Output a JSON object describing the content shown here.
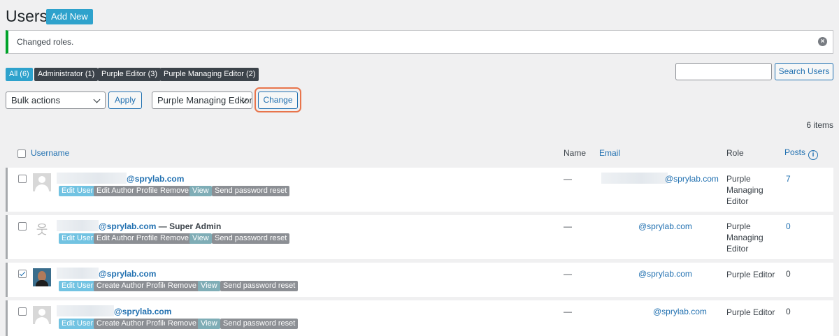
{
  "header": {
    "title": "Users",
    "add_new": "Add New"
  },
  "notice": {
    "message": "Changed roles.",
    "dismiss": "×"
  },
  "filters": [
    {
      "label": "All (6)",
      "active": true
    },
    {
      "label": "Administrator (1)"
    },
    {
      "label": "Purple Editor (3)"
    },
    {
      "label": "Purple Managing Editor (2)"
    }
  ],
  "search": {
    "placeholder": "",
    "button": "Search Users"
  },
  "bulk": {
    "selected": "Bulk actions",
    "apply": "Apply"
  },
  "role_change": {
    "selected": "Purple Managing Editor",
    "button": "Change"
  },
  "items_count": "6 items",
  "columns": {
    "username": "Username",
    "name": "Name",
    "email": "Email",
    "role": "Role",
    "posts": "Posts"
  },
  "colors": {
    "accent": "#2271b1",
    "notice_border": "#00a32a",
    "highlight": "#e8744b"
  },
  "rows": [
    {
      "username": "@sprylab.com",
      "suffix": "",
      "name": "—",
      "email": "@sprylab.com",
      "role": "Purple Managing Editor",
      "posts": "7",
      "checked": false,
      "avatar": "generic",
      "actions": [
        "Edit User",
        "Edit Author Profile",
        "Remove",
        "View",
        "Send password reset"
      ]
    },
    {
      "username": "@sprylab.com",
      "suffix": " — Super Admin",
      "name": "—",
      "email": "@sprylab.com",
      "role": "Purple Managing Editor",
      "posts": "0",
      "checked": false,
      "avatar": "stick",
      "actions": [
        "Edit User",
        "Edit Author Profile",
        "Remove",
        "View",
        "Send password reset"
      ]
    },
    {
      "username": "@sprylab.com",
      "suffix": "",
      "name": "—",
      "email": "@sprylab.com",
      "role": "Purple Editor",
      "posts": "0",
      "checked": true,
      "avatar": "photo",
      "actions": [
        "Edit User",
        "Create Author Profile",
        "Remove",
        "View",
        "Send password reset"
      ]
    },
    {
      "username": "@sprylab.com",
      "suffix": "",
      "name": "—",
      "email": "@sprylab.com",
      "role": "Purple Editor",
      "posts": "0",
      "checked": false,
      "avatar": "generic",
      "actions": [
        "Edit User",
        "Create Author Profile",
        "Remove",
        "View",
        "Send password reset"
      ]
    }
  ]
}
